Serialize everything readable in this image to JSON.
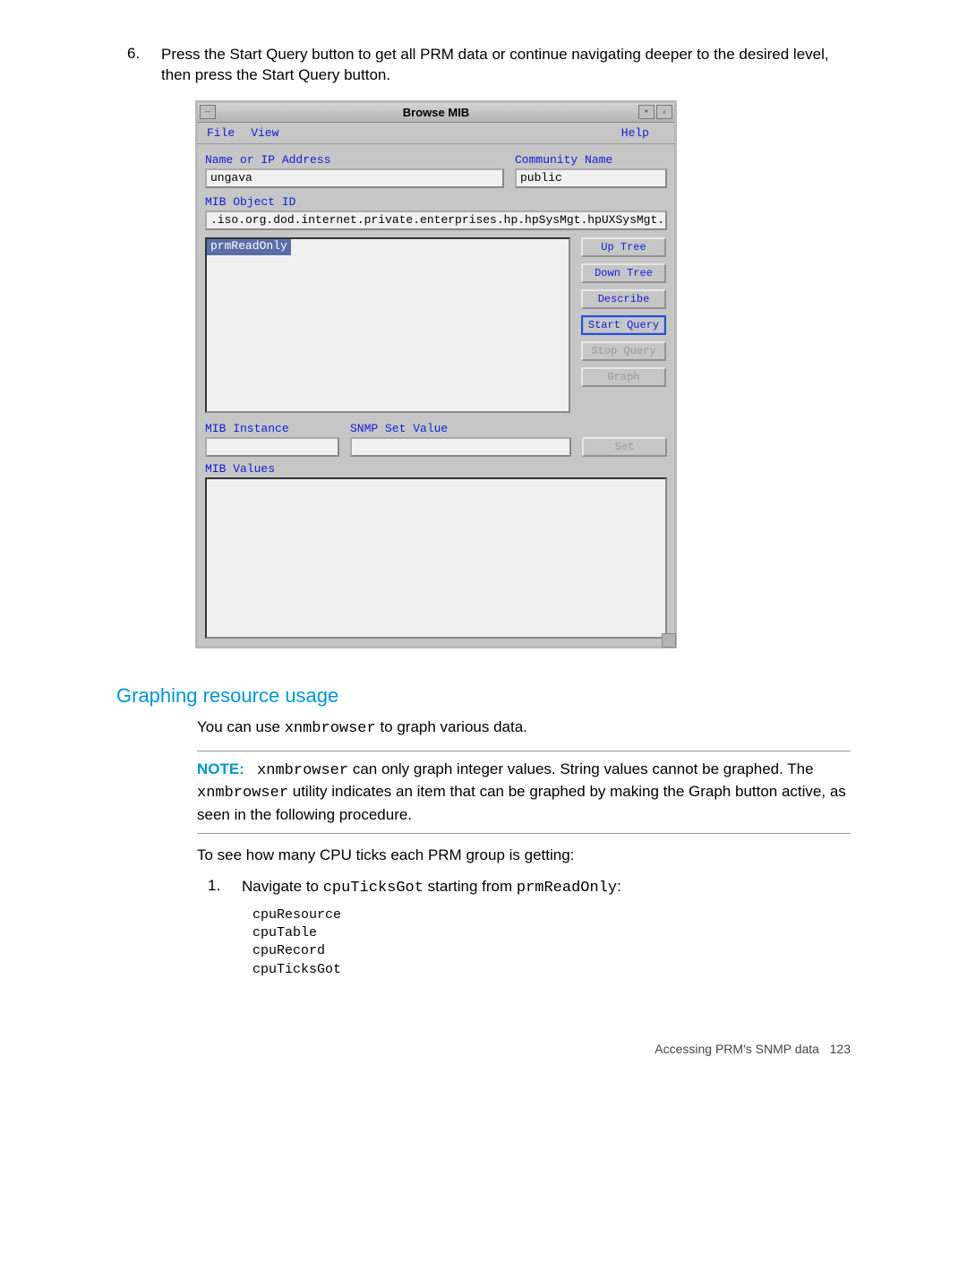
{
  "intro": {
    "step6_num": "6.",
    "step6_text": "Press the Start Query button to get all PRM data or continue navigating deeper to the desired level, then press the Start Query button."
  },
  "window": {
    "title": "Browse MIB",
    "sys": {
      "menu": "—",
      "min": "▾",
      "max": "▵"
    },
    "menubar": {
      "file": "File",
      "view": "View",
      "help": "Help"
    },
    "labels": {
      "name_ip": "Name or IP Address",
      "community": "Community Name",
      "mib_obj": "MIB Object ID",
      "mib_instance": "MIB Instance",
      "snmp_set": "SNMP Set Value",
      "mib_values": "MIB Values"
    },
    "fields": {
      "name_ip": "ungava",
      "community": "public",
      "mib_obj": ".iso.org.dod.internet.private.enterprises.hp.hpSysMgt.hpUXSysMgt.hpPRM",
      "list_item": "prmReadOnly",
      "mib_instance": "",
      "snmp_set": ""
    },
    "buttons": {
      "up_tree": "Up Tree",
      "down_tree": "Down Tree",
      "describe": "Describe",
      "start_query": "Start Query",
      "stop_query": "Stop Query",
      "graph": "Graph",
      "set": "Set"
    }
  },
  "section": {
    "heading": "Graphing resource usage",
    "para1_a": "You can use ",
    "para1_code": "xnmbrowser",
    "para1_b": " to graph various data.",
    "note_label": "NOTE:",
    "note_body_a": " can only graph integer values. String values cannot be graphed. The ",
    "note_body_b": " utility indicates an item that can be graphed by making the Graph button active, as seen in the following procedure.",
    "para2": "To see how many CPU ticks each PRM group is getting:",
    "step1_num": "1.",
    "step1_a": "Navigate to ",
    "step1_code1": "cpuTicksGot",
    "step1_b": " starting from ",
    "step1_code2": "prmReadOnly",
    "step1_c": ":",
    "step1_sub": "cpuResource\ncpuTable\ncpuRecord\ncpuTicksGot"
  },
  "footer": {
    "text": "Accessing PRM's SNMP data",
    "page": "123"
  }
}
